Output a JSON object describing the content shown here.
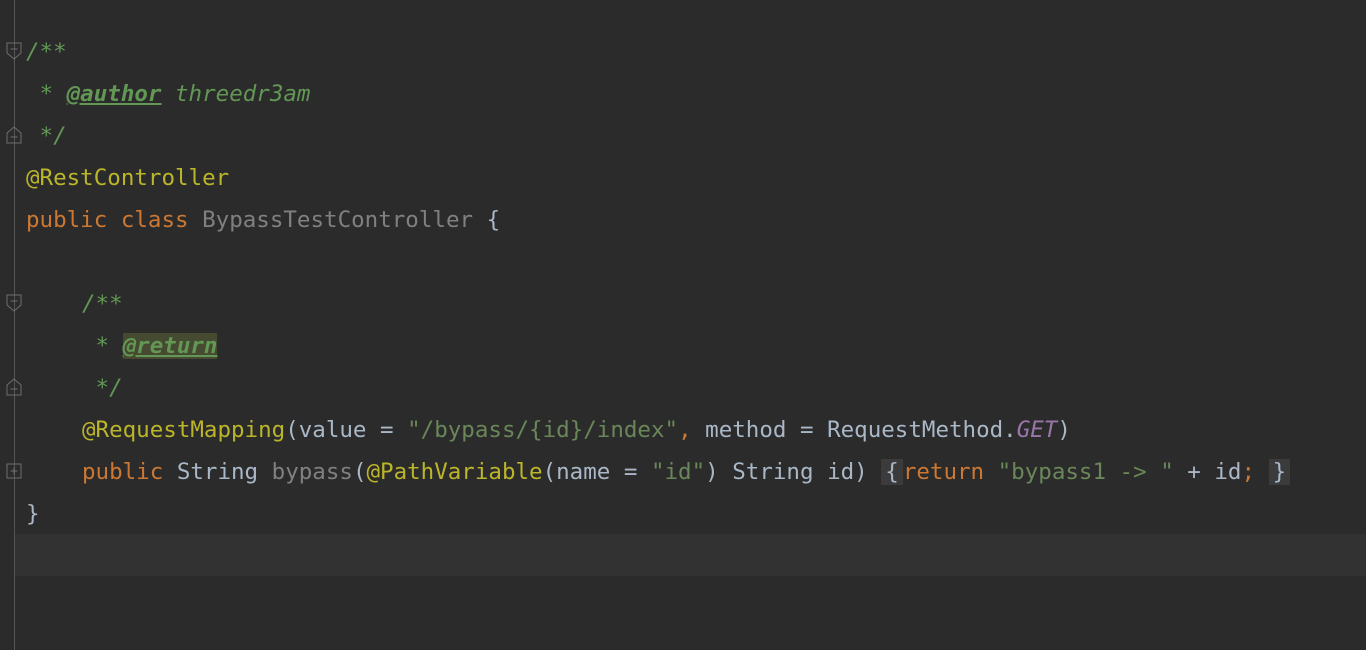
{
  "editor": {
    "lines": {
      "l1": {
        "comment_open": "/**"
      },
      "l2": {
        "star": " * ",
        "tag": "@author",
        "author": " threedr3am"
      },
      "l3": {
        "comment_close": " */"
      },
      "l4": {
        "annotation": "@RestController"
      },
      "l5": {
        "kw_public": "public",
        "kw_class": "class",
        "class_name": "BypassTestController",
        "brace": "{"
      },
      "l7": {
        "comment_open": "/**"
      },
      "l8": {
        "star": " * ",
        "tag": "@return"
      },
      "l9": {
        "comment_close": " */"
      },
      "l10": {
        "annotation": "@RequestMapping",
        "open": "(value = ",
        "path": "\"/bypass/{id}/index\"",
        "comma": ",",
        "method_part": " method = RequestMethod.",
        "get": "GET",
        "close": ")"
      },
      "l11": {
        "kw_public": "public",
        "type": "String",
        "method_name": "bypass",
        "paren": "(",
        "annotation": "@PathVariable",
        "name_part": "(name = ",
        "id_str": "\"id\"",
        "param": ") String id)",
        "lbrace": "{",
        "kw_return": "return",
        "ret_str": "\"bypass1 -> \"",
        "concat": " + id",
        "semi": ";",
        "rbrace": "}"
      },
      "l12": {
        "brace": "}"
      }
    }
  }
}
